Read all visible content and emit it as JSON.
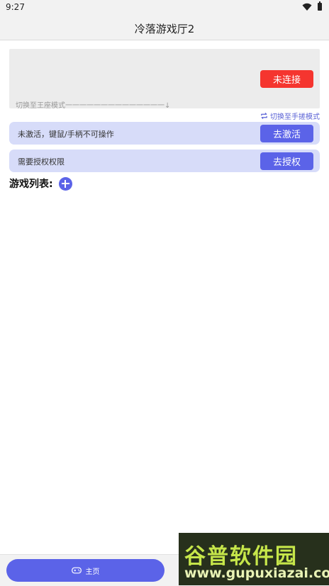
{
  "status_bar": {
    "time": "9:27"
  },
  "app_bar": {
    "title": "冷落游戏厅2"
  },
  "connection": {
    "button_label": "未连接",
    "switch_text": "切换至王座模式一一一一一一一一一一一一一一↓"
  },
  "mode_switch": {
    "label": "切换至手搓模式"
  },
  "activation_row": {
    "text": "未激活，键鼠/手柄不可操作",
    "button_label": "去激活"
  },
  "authorization_row": {
    "text": "需要授权权限",
    "button_label": "去授权"
  },
  "game_list": {
    "label": "游戏列表:"
  },
  "bottom_nav": {
    "home_label": "主页"
  },
  "watermark": {
    "logo": "谷普软件园",
    "url": "www.gupuxiazai.com"
  },
  "colors": {
    "accent": "#5b63e8",
    "danger": "#f5352f",
    "row_background": "#d7dcf9"
  }
}
